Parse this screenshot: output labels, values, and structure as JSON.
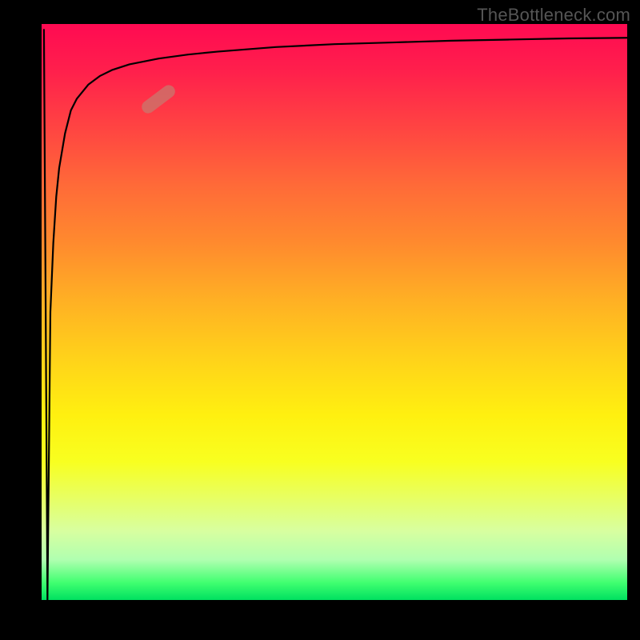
{
  "watermark": {
    "text": "TheBottleneck.com"
  },
  "plot": {
    "background_gradient_top": "#ff0a52",
    "background_gradient_bottom": "#00e060",
    "curve_color": "#000000",
    "marker_color": "rgba(200,120,110,0.75)"
  },
  "chart_data": {
    "type": "line",
    "title": "",
    "xlabel": "",
    "ylabel": "",
    "xlim": [
      0,
      100
    ],
    "ylim": [
      0,
      100
    ],
    "grid": false,
    "legend": false,
    "annotations": [
      {
        "text": "TheBottleneck.com",
        "position": "top-right"
      }
    ],
    "series": [
      {
        "name": "curve",
        "x": [
          1.0,
          1.5,
          2.0,
          2.5,
          3.0,
          3.5,
          4.0,
          5.0,
          6.0,
          8.0,
          10.0,
          12.0,
          15.0,
          20.0,
          25.0,
          30.0,
          40.0,
          50.0,
          60.0,
          70.0,
          80.0,
          90.0,
          100.0
        ],
        "y": [
          0.0,
          50.0,
          62.0,
          70.0,
          75.0,
          78.0,
          81.0,
          85.0,
          87.0,
          89.5,
          91.0,
          92.0,
          93.0,
          94.0,
          94.7,
          95.2,
          96.0,
          96.5,
          96.8,
          97.1,
          97.3,
          97.5,
          97.6
        ]
      }
    ],
    "marker": {
      "x": 20.0,
      "y": 87.0,
      "angle_deg": -37
    }
  }
}
